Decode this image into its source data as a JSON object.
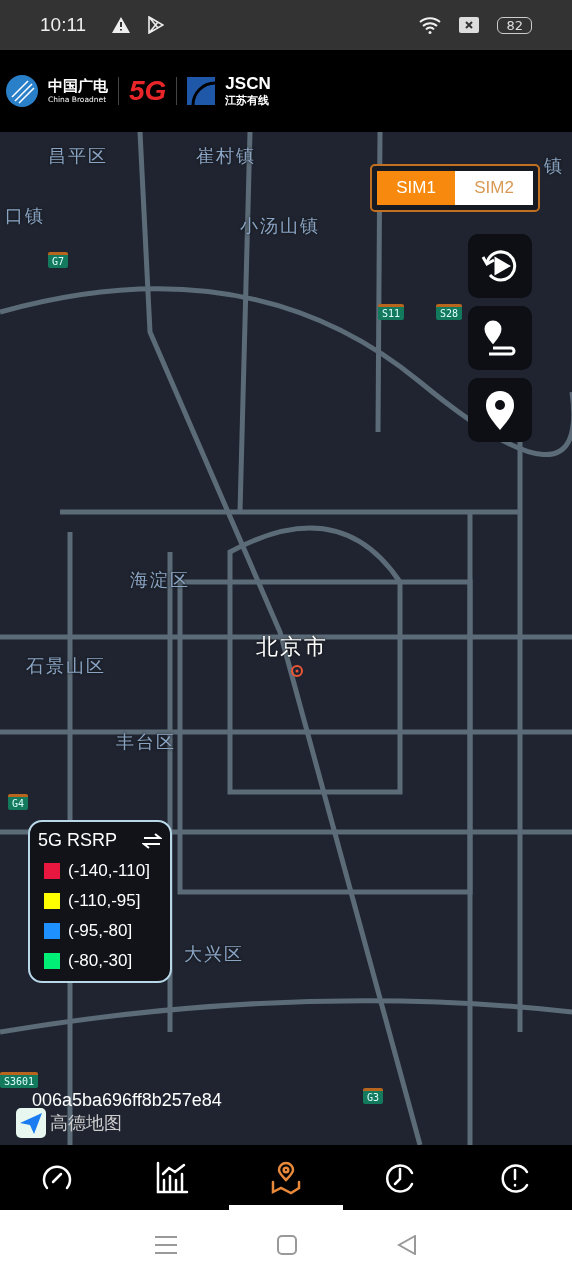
{
  "status_bar": {
    "time": "10:11",
    "battery": "82"
  },
  "header": {
    "brand_cn": "中国广电",
    "brand_en": "China Broadnet",
    "logo_5g": "5G",
    "jscn": "JSCN",
    "jscn_cn": "江苏有线"
  },
  "map": {
    "labels": [
      {
        "text": "昌平区",
        "kind": "district"
      },
      {
        "text": "崔村镇",
        "kind": "district"
      },
      {
        "text": "镇",
        "kind": "district"
      },
      {
        "text": "口镇",
        "kind": "district"
      },
      {
        "text": "小汤山镇",
        "kind": "district"
      },
      {
        "text": "海淀区",
        "kind": "district"
      },
      {
        "text": "北京市",
        "kind": "city"
      },
      {
        "text": "石景山区",
        "kind": "district"
      },
      {
        "text": "丰台区",
        "kind": "district"
      },
      {
        "text": "大兴区",
        "kind": "district"
      }
    ],
    "shields": [
      {
        "text": "G7"
      },
      {
        "text": "S11"
      },
      {
        "text": "S28"
      },
      {
        "text": "G4"
      },
      {
        "text": "S3601"
      },
      {
        "text": "G3"
      }
    ],
    "sim_tabs": [
      {
        "label": "SIM1",
        "selected": true
      },
      {
        "label": "SIM2",
        "selected": false
      }
    ],
    "legend": {
      "title": "5G RSRP",
      "items": [
        {
          "label": "(-140,-110]",
          "color": "#e8173f"
        },
        {
          "label": "(-110,-95]",
          "color": "#ffff00"
        },
        {
          "label": "(-95,-80]",
          "color": "#1e90ff"
        },
        {
          "label": "(-80,-30]",
          "color": "#00ee76"
        }
      ]
    },
    "device_id": "006a5ba696ff8b257e84",
    "map_brand": "高德地图"
  },
  "bottom_tabs": [
    {
      "kind": "speed",
      "selected": false
    },
    {
      "kind": "stats",
      "selected": false
    },
    {
      "kind": "map",
      "selected": true
    },
    {
      "kind": "history",
      "selected": false
    },
    {
      "kind": "alert",
      "selected": false
    }
  ]
}
